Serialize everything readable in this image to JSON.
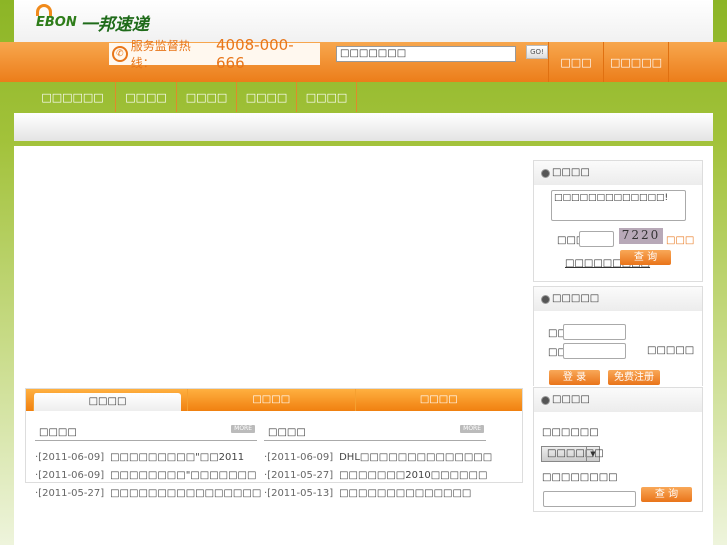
{
  "header": {
    "logo_mark": "EBON",
    "logo_text": "一邦速递",
    "hotline_label": "服务监督热线：",
    "hotline_number": "4008-000-666",
    "search_value": "□□□□□□□",
    "go_label": "GO!",
    "top_links": [
      "□□□",
      "□□□□□"
    ]
  },
  "nav": [
    "□□□□□□",
    "□□□□",
    "□□□□",
    "□□□□",
    "□□□□"
  ],
  "tracking": {
    "title": "□□□□",
    "textarea_value": "□□□□□□□□□□□□□!",
    "captcha_label": "□□□:",
    "captcha_image": "7220",
    "refresh_link": "□□□",
    "help_link": "□□□□□□□□□",
    "query_button": "查  询"
  },
  "login": {
    "title": "□□□□□",
    "user_label": "□□:",
    "pass_label": "□□:",
    "forgot_text": "□□□□□",
    "login_button": "登  录",
    "register_button": "免费注册"
  },
  "price": {
    "title": "□□□□",
    "label1": "□□□□□□",
    "select_value": "□□□□□□",
    "label2": "□□□□□□□□",
    "query_button": "查  询"
  },
  "tabs": {
    "items": [
      "□□□□",
      "□□□□",
      "□□□□"
    ],
    "left": {
      "title": "□□□□",
      "more": "MORE",
      "news": [
        {
          "date": "·[2011-06-09]",
          "title": "□□□□□□□□□\"□□2011"
        },
        {
          "date": "·[2011-06-09]",
          "title": "□□□□□□□□\"□□□□□□□"
        },
        {
          "date": "·[2011-05-27]",
          "title": "□□□□□□□□□□□□□□□□"
        }
      ]
    },
    "right": {
      "title": "□□□□",
      "more": "MORE",
      "news": [
        {
          "date": "·[2011-06-09]",
          "title": "DHL□□□□□□□□□□□□□□"
        },
        {
          "date": "·[2011-05-27]",
          "title": "□□□□□□□2010□□□□□□"
        },
        {
          "date": "·[2011-05-13]",
          "title": "□□□□□□□□□□□□□□"
        }
      ]
    }
  }
}
